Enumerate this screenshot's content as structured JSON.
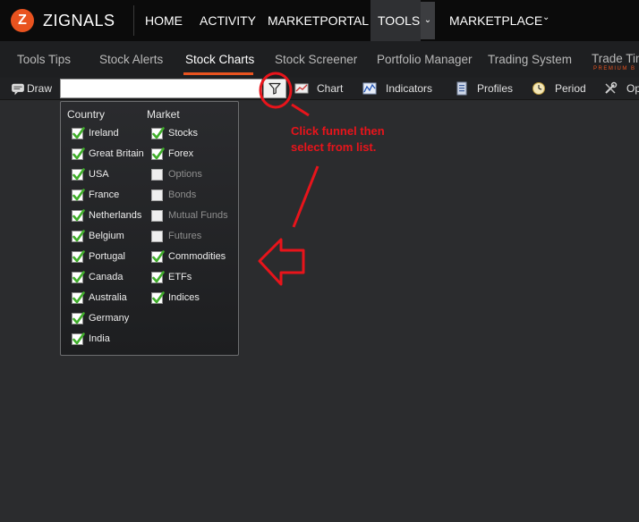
{
  "brand": {
    "logo_letter": "Z",
    "name": "ZIGNALS"
  },
  "top_nav": {
    "home": "HOME",
    "activity": "ACTIVITY",
    "marketportal": "MARKETPORTAL",
    "tools": "TOOLS",
    "marketplace": "MARKETPLACE"
  },
  "sub_nav": {
    "tools_tips": "Tools Tips",
    "stock_alerts": "Stock Alerts",
    "stock_charts": "Stock Charts",
    "stock_screener": "Stock Screener",
    "portfolio_manager": "Portfolio Manager",
    "trading_system": "Trading System",
    "trade_timing": "Trade Tim",
    "premium_tag": "PREMIUM B"
  },
  "toolbar": {
    "draw": "Draw",
    "search_value": "",
    "chart": "Chart",
    "indicators": "Indicators",
    "profiles": "Profiles",
    "period": "Period",
    "options": "Op"
  },
  "filter": {
    "country_heading": "Country",
    "market_heading": "Market",
    "countries": [
      {
        "label": "Ireland",
        "checked": true
      },
      {
        "label": "Great Britain",
        "checked": true
      },
      {
        "label": "USA",
        "checked": true
      },
      {
        "label": "France",
        "checked": true
      },
      {
        "label": "Netherlands",
        "checked": true
      },
      {
        "label": "Belgium",
        "checked": true
      },
      {
        "label": "Portugal",
        "checked": true
      },
      {
        "label": "Canada",
        "checked": true
      },
      {
        "label": "Australia",
        "checked": true
      },
      {
        "label": "Germany",
        "checked": true
      },
      {
        "label": "India",
        "checked": true
      }
    ],
    "markets": [
      {
        "label": "Stocks",
        "checked": true
      },
      {
        "label": "Forex",
        "checked": true
      },
      {
        "label": "Options",
        "checked": false
      },
      {
        "label": "Bonds",
        "checked": false
      },
      {
        "label": "Mutual Funds",
        "checked": false
      },
      {
        "label": "Futures",
        "checked": false
      },
      {
        "label": "Commodities",
        "checked": true
      },
      {
        "label": "ETFs",
        "checked": true
      },
      {
        "label": "Indices",
        "checked": true
      }
    ]
  },
  "annotation": {
    "text": "Click funnel then\nselect from list."
  },
  "colors": {
    "accent": "#e9531f",
    "annotation_red": "#e8141b",
    "check_green": "#3fae2a",
    "background": "#2b2c2e"
  }
}
